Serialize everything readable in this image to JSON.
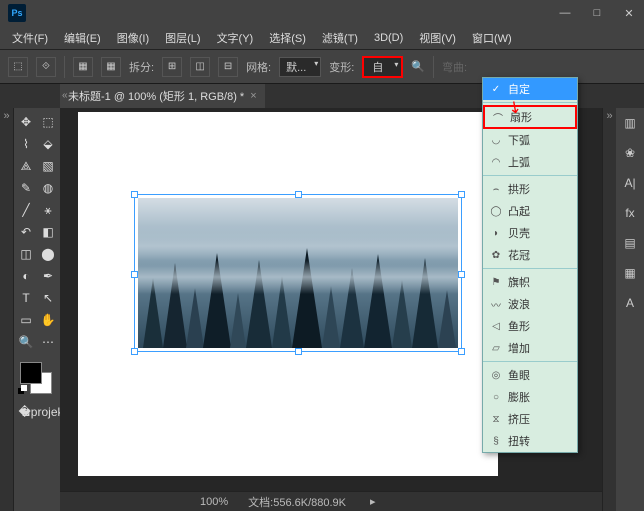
{
  "titlebar": {
    "logo": "Ps"
  },
  "menu": [
    "文件(F)",
    "编辑(E)",
    "图像(I)",
    "图层(L)",
    "文字(Y)",
    "选择(S)",
    "滤镜(T)",
    "3D(D)",
    "视图(V)",
    "窗口(W)"
  ],
  "optbar": {
    "split_label": "拆分:",
    "grid_label": "网格:",
    "grid_value": "默...",
    "warp_label": "变形:",
    "warp_value": "自",
    "bend_label": "弯曲:"
  },
  "doctab": {
    "title": "未标题-1 @ 100% (矩形 1, RGB/8) *"
  },
  "status": {
    "zoom": "100%",
    "doc_label": "文档:",
    "doc_value": "556.6K/880.9K"
  },
  "warp_menu": {
    "section1": [
      {
        "icon": "✓",
        "label": "自定"
      }
    ],
    "section2": [
      {
        "icon": "⌒",
        "label": "扇形",
        "hl": true
      },
      {
        "icon": "◡",
        "label": "下弧"
      },
      {
        "icon": "◠",
        "label": "上弧"
      }
    ],
    "section3": [
      {
        "icon": "⌢",
        "label": "拱形"
      },
      {
        "icon": "◯",
        "label": "凸起"
      },
      {
        "icon": "◗",
        "label": "贝壳"
      },
      {
        "icon": "✿",
        "label": "花冠"
      }
    ],
    "section4": [
      {
        "icon": "⚑",
        "label": "旗帜"
      },
      {
        "icon": "〰",
        "label": "波浪"
      },
      {
        "icon": "◁",
        "label": "鱼形"
      },
      {
        "icon": "▱",
        "label": "增加"
      }
    ],
    "section5": [
      {
        "icon": "◎",
        "label": "鱼眼"
      },
      {
        "icon": "○",
        "label": "膨胀"
      },
      {
        "icon": "⧖",
        "label": "挤压"
      },
      {
        "icon": "§",
        "label": "扭转"
      }
    ]
  },
  "right_panel": [
    "▥",
    "❀",
    "A|",
    "fx",
    "▤",
    "▦",
    "A"
  ]
}
